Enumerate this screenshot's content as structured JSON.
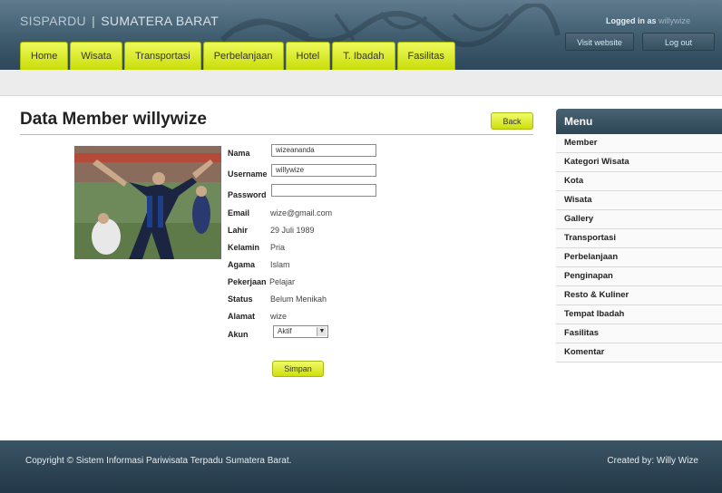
{
  "header": {
    "brand_part1": "SISPARDU",
    "brand_sep": "|",
    "brand_part2": "SUMATERA BARAT",
    "logged_in_prefix": "Logged in as",
    "logged_in_user": "willywize",
    "visit_label": "Visit website",
    "logout_label": "Log out"
  },
  "nav": {
    "items": [
      "Home",
      "Wisata",
      "Transportasi",
      "Perbelanjaan",
      "Hotel",
      "T. Ibadah",
      "Fasilitas"
    ]
  },
  "main": {
    "title": "Data Member willywize",
    "back_label": "Back",
    "photo_icon": "member-photo",
    "form": {
      "nama_label": "Nama",
      "nama_value": "wizeananda",
      "username_label": "Username",
      "username_value": "willywize",
      "password_label": "Password",
      "password_value": "",
      "email_label": "Email",
      "email_value": "wize@gmail.com",
      "lahir_label": "Lahir",
      "lahir_value": "29 Juli 1989",
      "kelamin_label": "Kelamin",
      "kelamin_value": "Pria",
      "agama_label": "Agama",
      "agama_value": "Islam",
      "pekerjaan_label": "Pekerjaan",
      "pekerjaan_value": "Pelajar",
      "status_label": "Status",
      "status_value": "Belum Menikah",
      "alamat_label": "Alamat",
      "alamat_value": "wize",
      "akun_label": "Akun",
      "akun_value": "Aktif"
    },
    "save_label": "Simpan"
  },
  "sidebar": {
    "title": "Menu",
    "items": [
      "Member",
      "Kategori Wisata",
      "Kota",
      "Wisata",
      "Gallery",
      "Transportasi",
      "Perbelanjaan",
      "Penginapan",
      "Resto & Kuliner",
      "Tempat Ibadah",
      "Fasilitas",
      "Komentar"
    ]
  },
  "footer": {
    "copyright": "Copyright © Sistem Informasi Pariwisata Terpadu Sumatera Barat.",
    "credit": "Created by: Willy Wize"
  },
  "colors": {
    "header": "#3f5b6e",
    "tab_accent": "#d8ea1e",
    "footer": "#2b4252"
  }
}
